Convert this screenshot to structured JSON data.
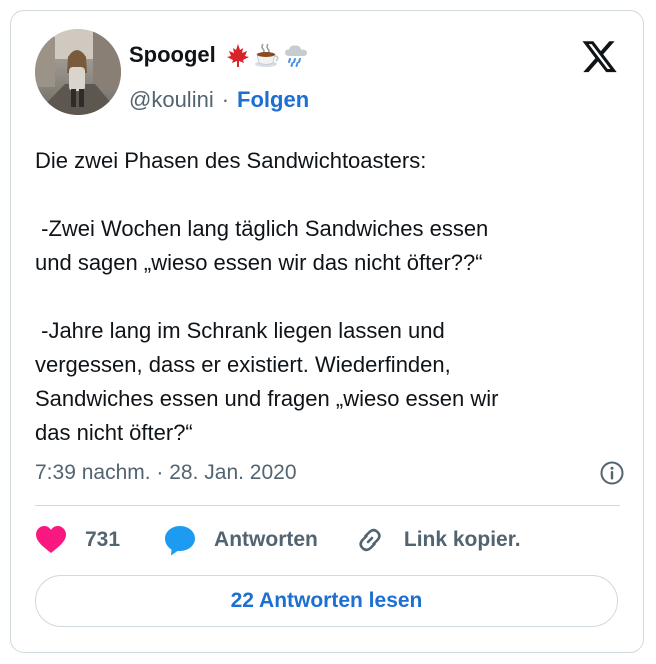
{
  "tweet": {
    "author": {
      "display_name": "Spoogel",
      "name_emojis": [
        "maple-leaf",
        "hot-beverage",
        "cloud-with-rain"
      ],
      "handle": "@koulini",
      "separator": "·",
      "follow_label": "Folgen"
    },
    "brand_icon": "x-logo",
    "text": "Die zwei Phasen des Sandwichtoasters:\n\n -Zwei Wochen lang täglich Sandwiches essen\nund sagen „wieso essen wir das nicht öfter??“\n\n -Jahre lang im Schrank liegen lassen und\nvergessen, dass er existiert. Wiederfinden,\nSandwiches essen und fragen „wieso essen wir\ndas nicht öfter?“",
    "timestamp": "7:39 nachm. · 28. Jan. 2020",
    "actions": {
      "likes_count": "731",
      "reply_label": "Antworten",
      "copy_link_label": "Link kopier."
    },
    "read_replies_label": "22 Antworten lesen"
  },
  "colors": {
    "accent_blue": "#1d6fd1",
    "like_pink": "#f91880",
    "reply_blue": "#1d9bf0",
    "secondary_text": "#536471",
    "border": "#cfd9de"
  }
}
